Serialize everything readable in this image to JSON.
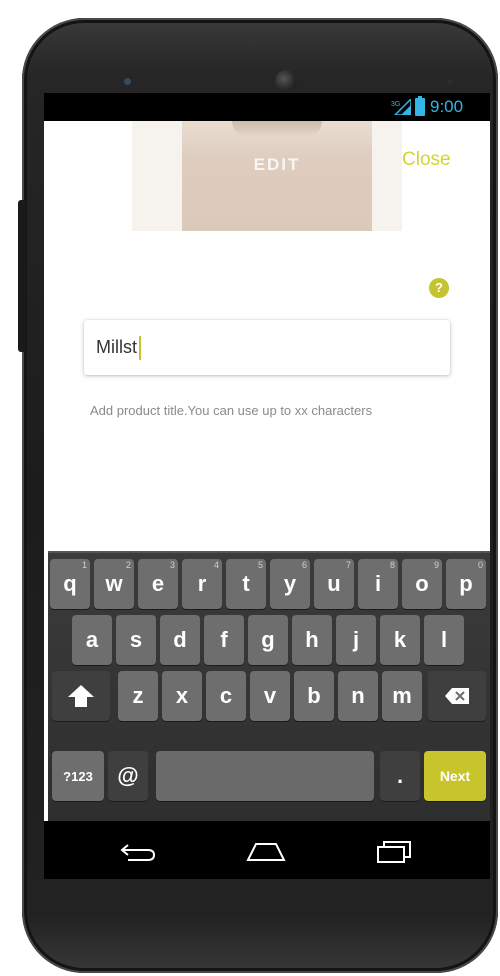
{
  "status_bar": {
    "time": "9:00",
    "network_label": "3G",
    "accent_color": "#33b5e5"
  },
  "photo": {
    "overlay_label": "EDIT"
  },
  "header": {
    "close_label": "Close"
  },
  "help": {
    "icon_glyph": "?"
  },
  "title_field": {
    "value": "Millst"
  },
  "helper_text": "Add product title.You can use up to xx characters",
  "keyboard": {
    "row1": [
      {
        "label": "q",
        "hint": "1"
      },
      {
        "label": "w",
        "hint": "2"
      },
      {
        "label": "e",
        "hint": "3"
      },
      {
        "label": "r",
        "hint": "4"
      },
      {
        "label": "t",
        "hint": "5"
      },
      {
        "label": "y",
        "hint": "6"
      },
      {
        "label": "u",
        "hint": "7"
      },
      {
        "label": "i",
        "hint": "8"
      },
      {
        "label": "o",
        "hint": "9"
      },
      {
        "label": "p",
        "hint": "0"
      }
    ],
    "row2": [
      "a",
      "s",
      "d",
      "f",
      "g",
      "h",
      "j",
      "k",
      "l"
    ],
    "row3": [
      "z",
      "x",
      "c",
      "v",
      "b",
      "n",
      "m"
    ],
    "symbols_label": "?123",
    "at_label": "@",
    "period_label": ".",
    "next_label": "Next",
    "next_color": "#c8c42c"
  },
  "nav": {
    "back_icon": "back-icon",
    "home_icon": "home-icon",
    "recents_icon": "recents-icon"
  }
}
